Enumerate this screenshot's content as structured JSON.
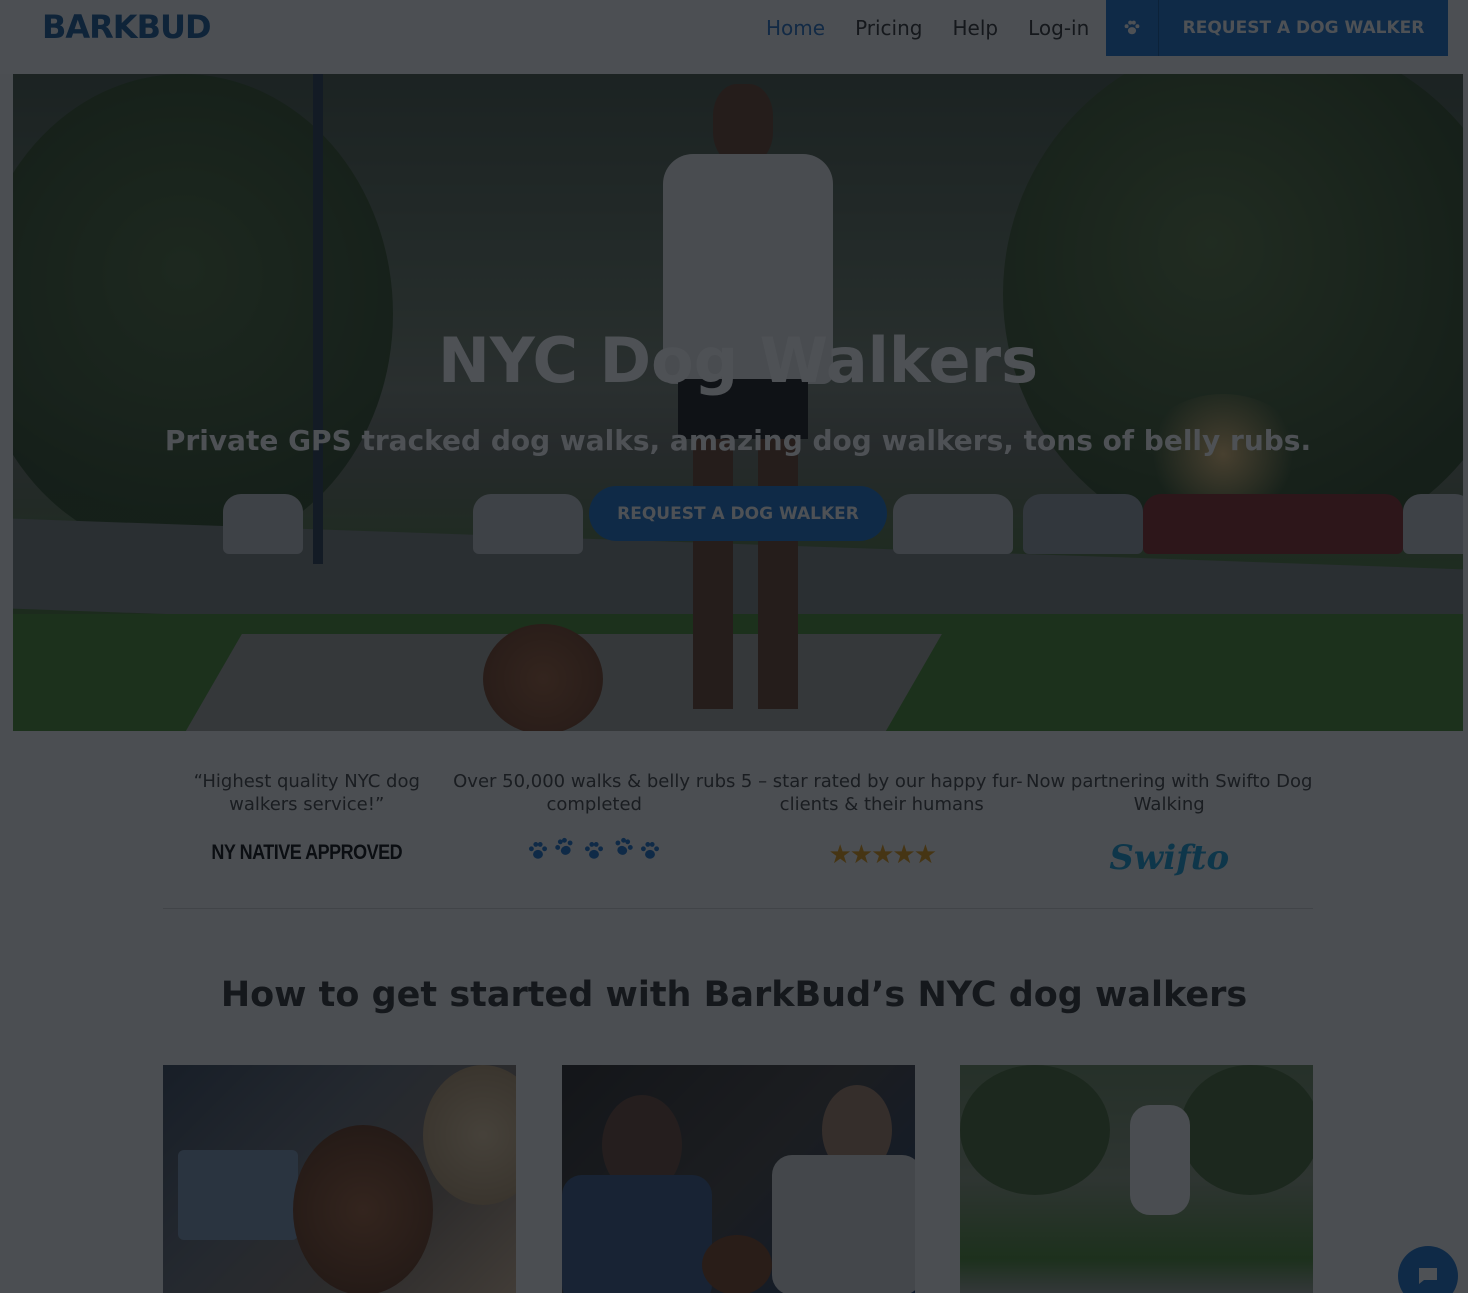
{
  "brand": {
    "logo_text": "BARKBUD"
  },
  "nav": {
    "items": [
      {
        "label": "Home",
        "active": true
      },
      {
        "label": "Pricing",
        "active": false
      },
      {
        "label": "Help",
        "active": false
      },
      {
        "label": "Log-in",
        "active": false
      }
    ],
    "cta_label": "REQUEST A DOG WALKER",
    "cta_icon": "paw-icon"
  },
  "hero": {
    "title": "NYC Dog Walkers",
    "subtitle": "Private GPS tracked dog walks, amazing dog walkers, tons of belly rubs.",
    "button_label": "REQUEST A DOG WALKER"
  },
  "features": [
    {
      "text": "“Highest quality NYC dog walkers service!”",
      "badge_text": "NY NATIVE APPROVED",
      "badge_type": "text-logo"
    },
    {
      "text": "Over 50,000 walks & belly rubs completed",
      "badge_type": "paw-prints",
      "badge_icon": "paw-icon"
    },
    {
      "text": "5 – star rated by our happy fur-clients & their humans",
      "badge_type": "stars",
      "rating": 5
    },
    {
      "text": "Now partnering with Swifto Dog Walking",
      "badge_text": "Swifto",
      "badge_type": "text-logo"
    }
  ],
  "section": {
    "title": "How to get started with BarkBud’s NYC dog walkers"
  },
  "colors": {
    "accent": "#1f75cc",
    "star": "#e39b16",
    "swifto": "#1b9fd6",
    "overlay": "rgba(10,14,20,0.72)"
  },
  "chat": {
    "icon": "chat-icon"
  }
}
